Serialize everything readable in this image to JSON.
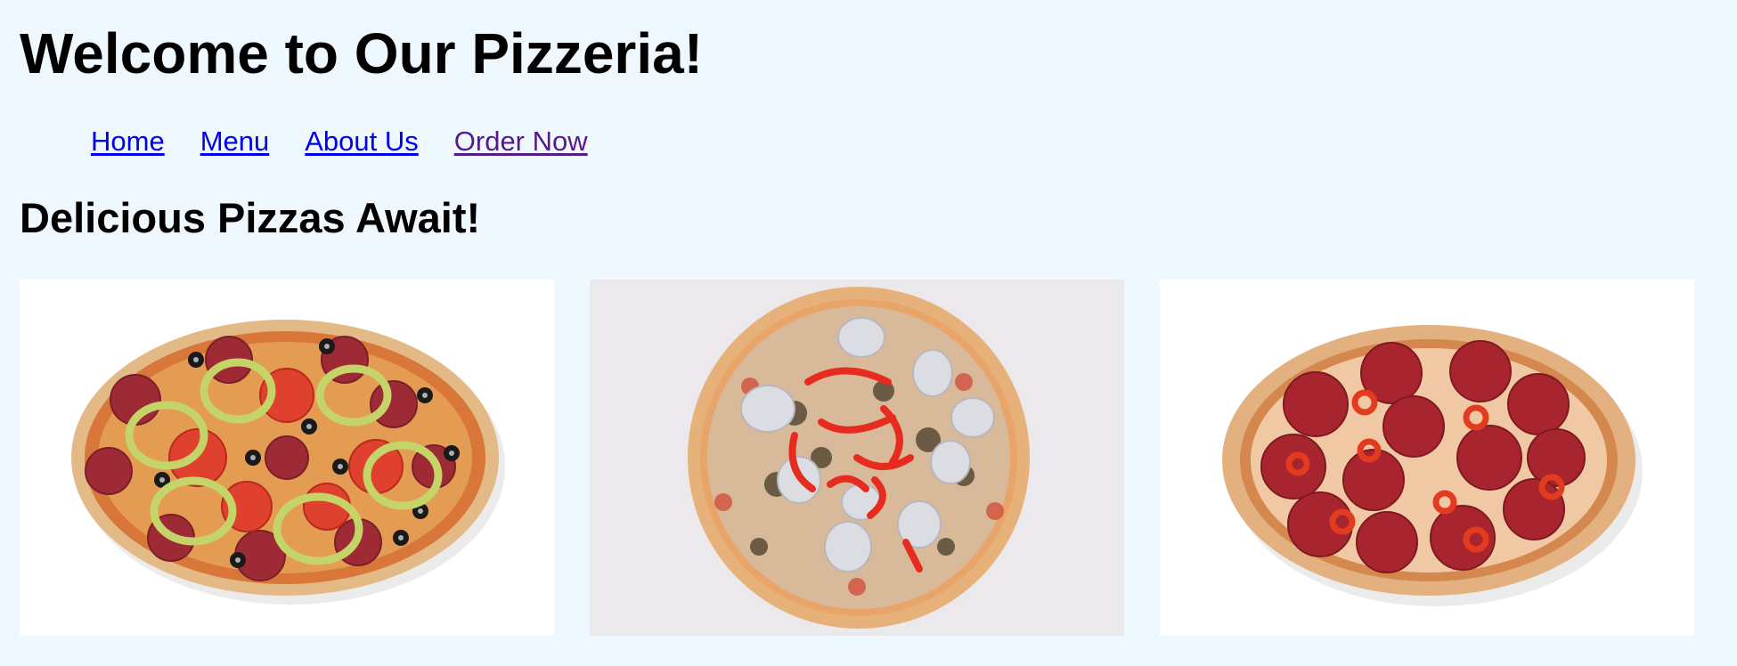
{
  "header": {
    "title": "Welcome to Our Pizzeria!"
  },
  "nav": {
    "items": [
      {
        "label": "Home"
      },
      {
        "label": "Menu"
      },
      {
        "label": "About Us"
      },
      {
        "label": "Order Now"
      }
    ]
  },
  "main": {
    "section_title": "Delicious Pizzas Await!",
    "pizzas": [
      {
        "icon": "veggie-pizza-image",
        "background": "#ffffff"
      },
      {
        "icon": "mushroom-pepper-pizza-image",
        "background": "#ebe9ec"
      },
      {
        "icon": "pepperoni-pizza-image",
        "background": "#ffffff"
      }
    ]
  },
  "colors": {
    "page_background": "#f0f8ff",
    "link": "#0000ee",
    "visited_link": "#551a8b"
  }
}
